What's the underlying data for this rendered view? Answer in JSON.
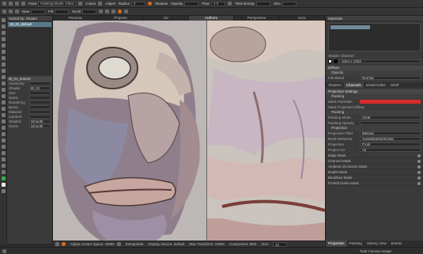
{
  "toolbar1": {
    "tool_label": "Paint",
    "mode_label": "Painting Mode: Clear",
    "colors_label": "Colors",
    "adjust_label": "Adjust",
    "radius_label": "Radius",
    "radius_value": "2",
    "shadow_label": "Shadow",
    "opacity_label": "Opacity",
    "flow_label": "Flow",
    "flow_value": "1.0",
    "tiled_label": "Tiled density",
    "size_label": "Size"
  },
  "toolbar2": {
    "new_label": "New",
    "filter_label": "Filt",
    "scroll_label": "Scroll"
  },
  "left_panel": {
    "title": "Sorted by: Shader",
    "layer_name": "Bl_01_default",
    "section_label": "Bl_01_texture",
    "props": [
      {
        "k": "Geometry",
        "v": ""
      },
      {
        "k": "Shader",
        "v": "Bl_01"
      },
      {
        "k": "Size",
        "v": ""
      },
      {
        "k": "Name",
        "v": ""
      },
      {
        "k": "Rendering",
        "v": ""
      },
      {
        "k": "Bump",
        "v": ""
      },
      {
        "k": "Material",
        "v": ""
      },
      {
        "k": "Lambert",
        "v": ""
      },
      {
        "k": "Shaded",
        "v": "Smooth"
      },
      {
        "k": "Name",
        "v": "Smooth"
      }
    ]
  },
  "viewport": {
    "tabs": [
      "Persona",
      "Projects",
      "UV",
      "Uniform",
      "Perspective",
      "Uvra"
    ],
    "active_tab": "Uniform"
  },
  "statusbar": {
    "uv_space": "Adjust Center Space: UM00",
    "mode": "Extrapolate",
    "display": "Display Device: default",
    "transform": "Max Transform: UM00",
    "component": "Component: M00",
    "size": "Size",
    "size_value": "40"
  },
  "bottombar": {
    "gpu": "Total Canvas Usage"
  },
  "right_panel": {
    "title": "Materials",
    "shader_label": "Shader Channel",
    "channel_value": "1024 x 1024",
    "diffuse_label": "Diffuse",
    "opacity_label": "Opacity",
    "blend_label": "File Blend",
    "blend_value": "Normal",
    "tabs": [
      "Shaders",
      "Channels",
      "Model Editor",
      "Shelf"
    ],
    "active_tab": "Channels",
    "projection_title": "Projection Settings",
    "paint_section": "Painting",
    "mask_label": "Mask Paintable",
    "mask_color": "#d92b2b",
    "mask_sub": "Mask Projected Diffuse",
    "painting_sub": "Painting",
    "painting_mode_k": "Painting Mode",
    "painting_mode_v": "Clear",
    "painting_opacity_k": "Painting Opacity",
    "projection_sub": "Projection",
    "proj_filter_k": "Projection Filter",
    "proj_filter_v": "Bilinear",
    "proj_behavior_k": "Brush Behavior",
    "proj_behavior_v": "AutoMaskedAtClear",
    "proj_type_k": "Projection",
    "proj_type_v": "Front",
    "proj_uv_k": "Project UV",
    "proj_uv_v": "All",
    "masks": [
      "Edge Mask",
      "Channel Mask",
      "Ambient Occlusion Mask",
      "Depth Mask",
      "Backface Mask",
      "Frontal Noise Mask"
    ],
    "bottom_tabs": [
      "Properties",
      "Painting",
      "History View",
      "Events"
    ],
    "active_bottom_tab": "Properties",
    "accent": "#e06a1e"
  }
}
